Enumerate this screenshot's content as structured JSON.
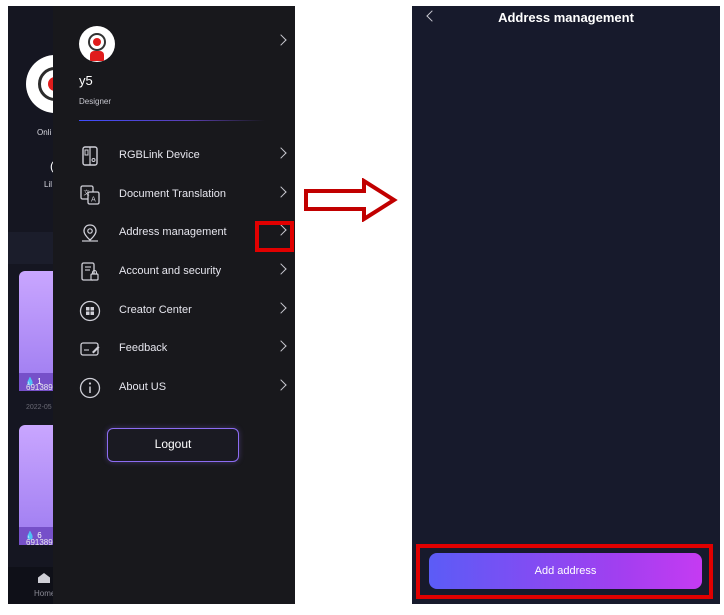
{
  "background_app": {
    "online_label": "Onli",
    "glyph_a": "(",
    "glyph_b": "Lil",
    "cards": [
      {
        "count": "1",
        "id_text": "691389",
        "date_text": "2022-05"
      },
      {
        "count": "6",
        "id_text": "691389"
      }
    ],
    "tabbar_label": "Home"
  },
  "drawer": {
    "user": {
      "name": "y5",
      "role": "Designer"
    },
    "menu": [
      {
        "label": "RGBLink Device",
        "icon": "device-icon"
      },
      {
        "label": "Document Translation",
        "icon": "translate-icon"
      },
      {
        "label": "Address management",
        "icon": "location-pin-icon"
      },
      {
        "label": "Account and security",
        "icon": "account-security-icon"
      },
      {
        "label": "Creator Center",
        "icon": "creator-center-icon"
      },
      {
        "label": "Feedback",
        "icon": "feedback-icon"
      },
      {
        "label": "About US",
        "icon": "info-icon"
      }
    ],
    "logout_label": "Logout"
  },
  "address_screen": {
    "title": "Address management",
    "add_button_label": "Add address"
  },
  "colors": {
    "highlight": "#e10000",
    "accent_start": "#5b5cf6",
    "accent_end": "#c53bf2",
    "drawer_bg": "#18181c",
    "screen_bg": "#171a2c"
  }
}
